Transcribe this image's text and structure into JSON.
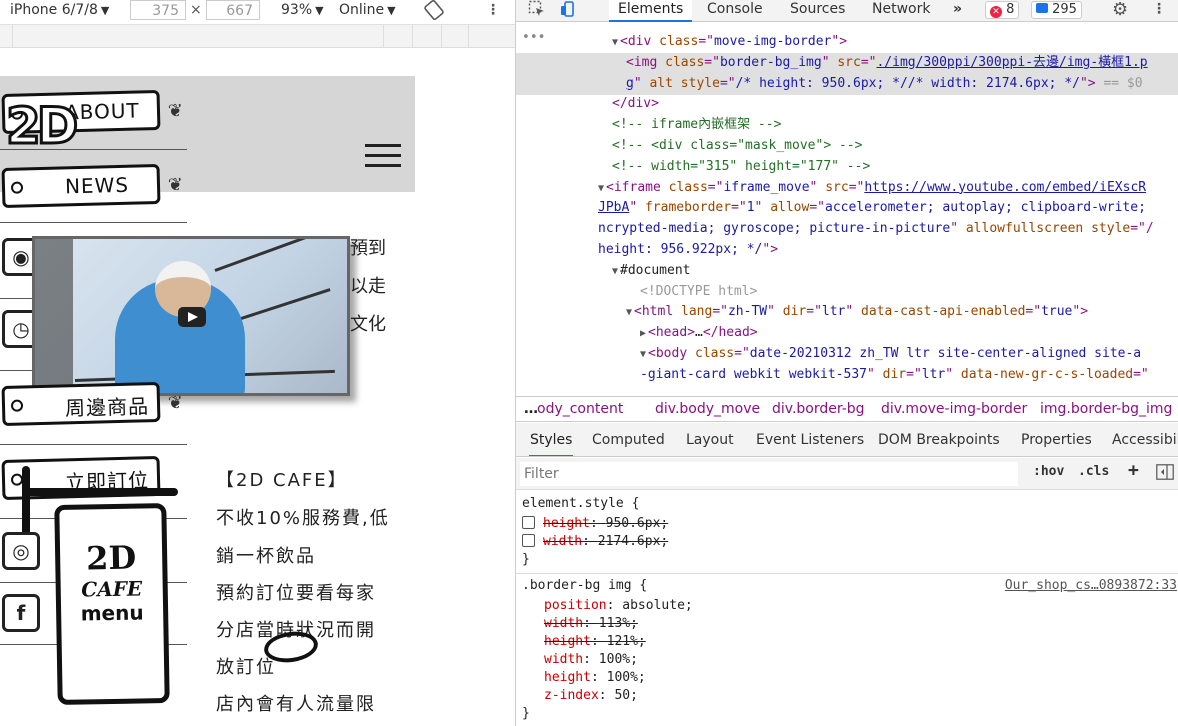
{
  "device_toolbar": {
    "device": "iPhone 6/7/8",
    "width": "375",
    "times": "×",
    "height": "667",
    "zoom": "93%",
    "network": "Online"
  },
  "site": {
    "nav": [
      "ABOUT",
      "NEWS",
      "周邊商品",
      "立即訂位"
    ],
    "peek_text": [
      "預到",
      "以走",
      "文化"
    ],
    "body_lines": [
      "【2D CAFE】",
      "不收10%服務費,低",
      "銷一杯飲品",
      "預約訂位要看每家",
      "分店當時狀況而開",
      "放訂位",
      "店內會有人流量限"
    ],
    "menu_sign": {
      "line1": "2D",
      "line2": "CAFE",
      "line3": "menu"
    },
    "logo": "2D"
  },
  "devtools": {
    "tabs": [
      "Elements",
      "Console",
      "Sources",
      "Network"
    ],
    "more_tabs": "»",
    "error_count": "8",
    "message_count": "295",
    "tree": [
      {
        "indent": 96,
        "tri": "▼",
        "html": "<span class='t'>&lt;div </span><span class='a'>class</span><span class='t'>=\"</span><span class='v'>move-img-border</span><span class='t'>\"&gt;</span>"
      },
      {
        "indent": 110,
        "tri": "",
        "html": "<span class='t'>&lt;img </span><span class='a'>class</span><span class='t'>=\"</span><span class='v'>border-bg_img</span><span class='t'>\" </span><span class='a'>src</span><span class='t'>=\"</span><span class='u'>./img/300ppi/300ppi-去邊/img-橫框1.p</span>",
        "sel": true
      },
      {
        "indent": 110,
        "tri": "",
        "html": "<span class='u'>g</span><span class='t'>\" </span><span class='a'>alt style</span><span class='t'>=\"</span><span class='v'>/* height: 950.6px; *//* width: 2174.6px; */</span><span class='t'>\"&gt;</span><span class='g'> == $0</span>",
        "sel": true
      },
      {
        "indent": 96,
        "tri": "",
        "html": "<span class='t'>&lt;/div&gt;</span>"
      },
      {
        "indent": 96,
        "tri": "",
        "html": "<span class='c'>&lt;!-- iframe內嵌框架 --&gt;</span>"
      },
      {
        "indent": 96,
        "tri": "",
        "html": "<span class='c'>&lt;!-- &lt;div class=\"mask_move\"&gt; --&gt;</span>"
      },
      {
        "indent": 96,
        "tri": "",
        "html": "<span class='c'>&lt;!-- width=\"315\" height=\"177\" --&gt;</span>"
      },
      {
        "indent": 82,
        "tri": "▼",
        "html": "<span class='t'>&lt;iframe </span><span class='a'>class</span><span class='t'>=\"</span><span class='v'>iframe_move</span><span class='t'>\" </span><span class='a'>src</span><span class='t'>=\"</span><span class='u'>https://www.youtube.com/embed/iEXscR</span>"
      },
      {
        "indent": 82,
        "tri": "",
        "html": "<span class='u'>JPbA</span><span class='t'>\" </span><span class='a'>frameborder</span><span class='t'>=\"</span><span class='v'>1</span><span class='t'>\" </span><span class='a'>allow</span><span class='t'>=\"</span><span class='v'>accelerometer; autoplay; clipboard-write;</span>"
      },
      {
        "indent": 82,
        "tri": "",
        "html": "<span class='v'>ncrypted-media; gyroscope; picture-in-picture</span><span class='t'>\" </span><span class='a'>allowfullscreen style</span><span class='t'>=\"/</span>"
      },
      {
        "indent": 82,
        "tri": "",
        "html": "<span class='v'>height: 956.922px; */</span><span class='t'>\"&gt;</span>"
      },
      {
        "indent": 96,
        "tri": "▼",
        "html": "<span class='x'>#document</span>"
      },
      {
        "indent": 124,
        "tri": "",
        "html": "<span class='g'>&lt;!DOCTYPE html&gt;</span>"
      },
      {
        "indent": 110,
        "tri": "▼",
        "html": "<span class='t'>&lt;html </span><span class='a'>lang</span><span class='t'>=\"</span><span class='v'>zh-TW</span><span class='t'>\" </span><span class='a'>dir</span><span class='t'>=\"</span><span class='v'>ltr</span><span class='t'>\" </span><span class='a'>data-cast-api-enabled</span><span class='t'>=\"</span><span class='v'>true</span><span class='t'>\"&gt;</span>"
      },
      {
        "indent": 124,
        "tri": "▶",
        "html": "<span class='t'>&lt;head&gt;</span><span class='x'>…</span><span class='t'>&lt;/head&gt;</span>"
      },
      {
        "indent": 124,
        "tri": "▼",
        "html": "<span class='t'>&lt;body </span><span class='a'>class</span><span class='t'>=\"</span><span class='v'>date-20210312 zh_TW ltr  site-center-aligned site-a</span>"
      },
      {
        "indent": 124,
        "tri": "",
        "html": "<span class='v'>-giant-card webkit webkit-537</span><span class='t'>\" </span><span class='a'>dir</span><span class='t'>=\"</span><span class='v'>ltr</span><span class='t'>\" </span><span class='a'>data-new-gr-c-s-loaded</span><span class='t'>=\"</span>"
      }
    ],
    "breadcrumbs": [
      "…",
      "ody_content",
      "div.body_move",
      "div.border-bg",
      "div.move-img-border",
      "img.border-bg_img"
    ],
    "sub_tabs": [
      "Styles",
      "Computed",
      "Layout",
      "Event Listeners",
      "DOM Breakpoints",
      "Properties",
      "Accessibili"
    ],
    "filter_placeholder": "Filter",
    "hov": ":hov",
    "cls": ".cls",
    "plus": "+",
    "styles": {
      "element_style_open": "element.style {",
      "element_props": [
        {
          "name": "height",
          "value": "950.6px;"
        },
        {
          "name": "width",
          "value": "2174.6px;"
        }
      ],
      "close": "}",
      "rule_selector": ".border-bg img {",
      "rule_source": "Our_shop_cs…0893872:33",
      "rule_props": [
        {
          "name": "position",
          "value": "absolute;",
          "struck": false
        },
        {
          "name": "width",
          "value": "113%;",
          "struck": true
        },
        {
          "name": "height",
          "value": "121%;",
          "struck": true
        },
        {
          "name": "width",
          "value": "100%;",
          "struck": false
        },
        {
          "name": "height",
          "value": "100%;",
          "struck": false
        },
        {
          "name": "z-index",
          "value": "50;",
          "struck": false
        }
      ]
    }
  }
}
